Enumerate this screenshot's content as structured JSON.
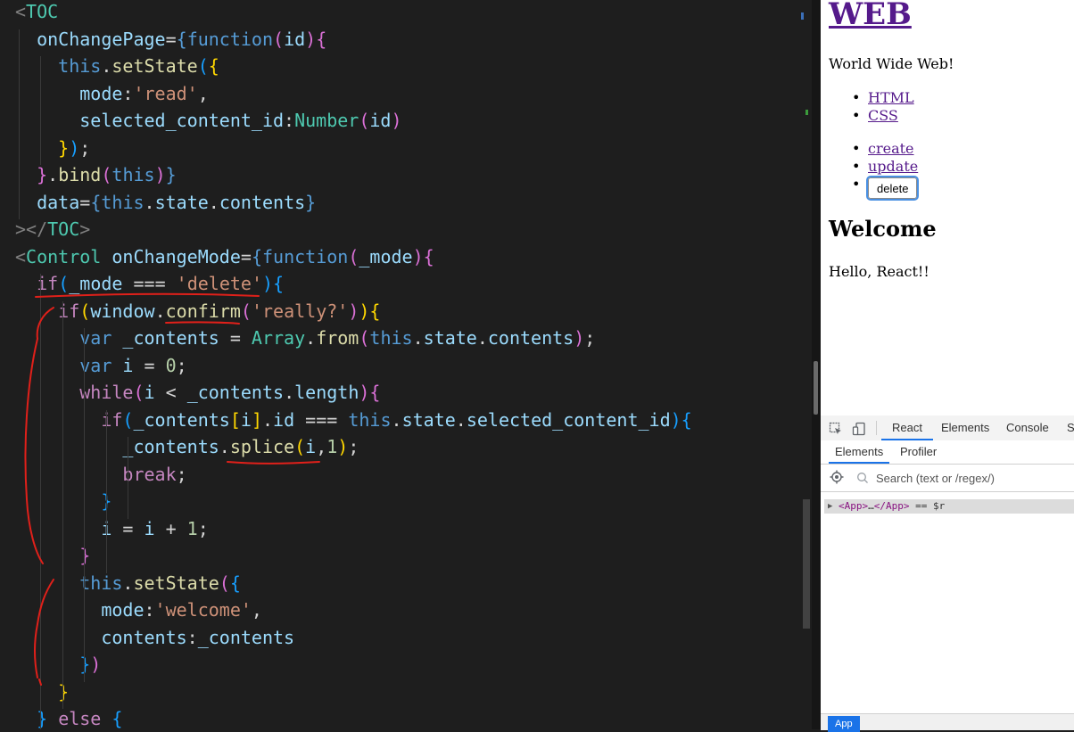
{
  "editor": {
    "lines": [
      [
        [
          "tk-tag",
          "<"
        ],
        [
          "tk-comp",
          "TOC"
        ]
      ],
      [
        [
          "tk-punc",
          "  "
        ],
        [
          "tk-attr",
          "onChangePage"
        ],
        [
          "tk-punc",
          "="
        ],
        [
          "tk-kw",
          "{"
        ],
        [
          "tk-kw",
          "function"
        ],
        [
          "tk-brace",
          "("
        ],
        [
          "tk-var",
          "id"
        ],
        [
          "tk-brace",
          ")"
        ],
        [
          "tk-brace",
          "{"
        ]
      ],
      [
        [
          "tk-punc",
          "    "
        ],
        [
          "tk-kw",
          "this"
        ],
        [
          "tk-punc",
          "."
        ],
        [
          "tk-fn",
          "setState"
        ],
        [
          "tk-brace2",
          "("
        ],
        [
          "tk-brace3",
          "{"
        ]
      ],
      [
        [
          "tk-punc",
          "      "
        ],
        [
          "tk-attr",
          "mode"
        ],
        [
          "tk-punc",
          ":"
        ],
        [
          "tk-str",
          "'read'"
        ],
        [
          "tk-punc",
          ","
        ]
      ],
      [
        [
          "tk-punc",
          "      "
        ],
        [
          "tk-attr",
          "selected_content_id"
        ],
        [
          "tk-punc",
          ":"
        ],
        [
          "tk-comp",
          "Number"
        ],
        [
          "tk-brace",
          "("
        ],
        [
          "tk-var",
          "id"
        ],
        [
          "tk-brace",
          ")"
        ]
      ],
      [
        [
          "tk-punc",
          "    "
        ],
        [
          "tk-brace3",
          "}"
        ],
        [
          "tk-brace2",
          ")"
        ],
        [
          "tk-punc",
          ";"
        ]
      ],
      [
        [
          "tk-punc",
          "  "
        ],
        [
          "tk-brace",
          "}"
        ],
        [
          "tk-punc",
          "."
        ],
        [
          "tk-fn",
          "bind"
        ],
        [
          "tk-brace",
          "("
        ],
        [
          "tk-kw",
          "this"
        ],
        [
          "tk-brace",
          ")"
        ],
        [
          "tk-kw",
          "}"
        ]
      ],
      [
        [
          "tk-punc",
          "  "
        ],
        [
          "tk-attr",
          "data"
        ],
        [
          "tk-punc",
          "="
        ],
        [
          "tk-kw",
          "{"
        ],
        [
          "tk-kw",
          "this"
        ],
        [
          "tk-punc",
          "."
        ],
        [
          "tk-var",
          "state"
        ],
        [
          "tk-punc",
          "."
        ],
        [
          "tk-var",
          "contents"
        ],
        [
          "tk-kw",
          "}"
        ]
      ],
      [
        [
          "tk-tag",
          "></"
        ],
        [
          "tk-comp",
          "TOC"
        ],
        [
          "tk-tag",
          ">"
        ]
      ],
      [
        [
          "tk-tag",
          "<"
        ],
        [
          "tk-comp",
          "Control"
        ],
        [
          "tk-punc",
          " "
        ],
        [
          "tk-attr",
          "onChangeMode"
        ],
        [
          "tk-punc",
          "="
        ],
        [
          "tk-kw",
          "{"
        ],
        [
          "tk-kw",
          "function"
        ],
        [
          "tk-brace",
          "("
        ],
        [
          "tk-var",
          "_mode"
        ],
        [
          "tk-brace",
          ")"
        ],
        [
          "tk-brace",
          "{"
        ]
      ],
      [
        [
          "tk-punc",
          "  "
        ],
        [
          "tk-ctl",
          "if"
        ],
        [
          "tk-brace2",
          "("
        ],
        [
          "tk-var",
          "_mode"
        ],
        [
          "tk-punc",
          " === "
        ],
        [
          "tk-str",
          "'delete'"
        ],
        [
          "tk-brace2",
          ")"
        ],
        [
          "tk-brace2",
          "{"
        ]
      ],
      [
        [
          "tk-punc",
          "    "
        ],
        [
          "tk-ctl",
          "if"
        ],
        [
          "tk-brace3",
          "("
        ],
        [
          "tk-var",
          "window"
        ],
        [
          "tk-punc",
          "."
        ],
        [
          "tk-fn",
          "confirm"
        ],
        [
          "tk-brace",
          "("
        ],
        [
          "tk-str",
          "'really?'"
        ],
        [
          "tk-brace",
          ")"
        ],
        [
          "tk-brace3",
          ")"
        ],
        [
          "tk-brace3",
          "{"
        ]
      ],
      [
        [
          "tk-punc",
          "      "
        ],
        [
          "tk-kw",
          "var"
        ],
        [
          "tk-punc",
          " "
        ],
        [
          "tk-var",
          "_contents"
        ],
        [
          "tk-punc",
          " = "
        ],
        [
          "tk-comp",
          "Array"
        ],
        [
          "tk-punc",
          "."
        ],
        [
          "tk-fn",
          "from"
        ],
        [
          "tk-brace",
          "("
        ],
        [
          "tk-kw",
          "this"
        ],
        [
          "tk-punc",
          "."
        ],
        [
          "tk-var",
          "state"
        ],
        [
          "tk-punc",
          "."
        ],
        [
          "tk-var",
          "contents"
        ],
        [
          "tk-brace",
          ")"
        ],
        [
          "tk-punc",
          ";"
        ]
      ],
      [
        [
          "tk-punc",
          "      "
        ],
        [
          "tk-kw",
          "var"
        ],
        [
          "tk-punc",
          " "
        ],
        [
          "tk-var",
          "i"
        ],
        [
          "tk-punc",
          " = "
        ],
        [
          "tk-num",
          "0"
        ],
        [
          "tk-punc",
          ";"
        ]
      ],
      [
        [
          "tk-punc",
          "      "
        ],
        [
          "tk-ctl",
          "while"
        ],
        [
          "tk-brace",
          "("
        ],
        [
          "tk-var",
          "i"
        ],
        [
          "tk-punc",
          " < "
        ],
        [
          "tk-var",
          "_contents"
        ],
        [
          "tk-punc",
          "."
        ],
        [
          "tk-var",
          "length"
        ],
        [
          "tk-brace",
          ")"
        ],
        [
          "tk-brace",
          "{"
        ]
      ],
      [
        [
          "tk-punc",
          "        "
        ],
        [
          "tk-ctl",
          "if"
        ],
        [
          "tk-brace2",
          "("
        ],
        [
          "tk-var",
          "_contents"
        ],
        [
          "tk-brace3",
          "["
        ],
        [
          "tk-var",
          "i"
        ],
        [
          "tk-brace3",
          "]"
        ],
        [
          "tk-punc",
          "."
        ],
        [
          "tk-var",
          "id"
        ],
        [
          "tk-punc",
          " === "
        ],
        [
          "tk-kw",
          "this"
        ],
        [
          "tk-punc",
          "."
        ],
        [
          "tk-var",
          "state"
        ],
        [
          "tk-punc",
          "."
        ],
        [
          "tk-var",
          "selected_content_id"
        ],
        [
          "tk-brace2",
          ")"
        ],
        [
          "tk-brace2",
          "{"
        ]
      ],
      [
        [
          "tk-punc",
          "          "
        ],
        [
          "tk-var",
          "_contents"
        ],
        [
          "tk-punc",
          "."
        ],
        [
          "tk-fn",
          "splice"
        ],
        [
          "tk-brace3",
          "("
        ],
        [
          "tk-var",
          "i"
        ],
        [
          "tk-punc",
          ","
        ],
        [
          "tk-num",
          "1"
        ],
        [
          "tk-brace3",
          ")"
        ],
        [
          "tk-punc",
          ";"
        ]
      ],
      [
        [
          "tk-punc",
          "          "
        ],
        [
          "tk-ctl",
          "break"
        ],
        [
          "tk-punc",
          ";"
        ]
      ],
      [
        [
          "tk-punc",
          "        "
        ],
        [
          "tk-brace2",
          "}"
        ]
      ],
      [
        [
          "tk-punc",
          "        "
        ],
        [
          "tk-var",
          "i"
        ],
        [
          "tk-punc",
          " = "
        ],
        [
          "tk-var",
          "i"
        ],
        [
          "tk-punc",
          " + "
        ],
        [
          "tk-num",
          "1"
        ],
        [
          "tk-punc",
          ";"
        ]
      ],
      [
        [
          "tk-punc",
          "      "
        ],
        [
          "tk-brace",
          "}"
        ]
      ],
      [
        [
          "tk-punc",
          "      "
        ],
        [
          "tk-kw",
          "this"
        ],
        [
          "tk-punc",
          "."
        ],
        [
          "tk-fn",
          "setState"
        ],
        [
          "tk-brace",
          "("
        ],
        [
          "tk-brace2",
          "{"
        ]
      ],
      [
        [
          "tk-punc",
          "        "
        ],
        [
          "tk-attr",
          "mode"
        ],
        [
          "tk-punc",
          ":"
        ],
        [
          "tk-str",
          "'welcome'"
        ],
        [
          "tk-punc",
          ","
        ]
      ],
      [
        [
          "tk-punc",
          "        "
        ],
        [
          "tk-attr",
          "contents"
        ],
        [
          "tk-punc",
          ":"
        ],
        [
          "tk-var",
          "_contents"
        ]
      ],
      [
        [
          "tk-punc",
          "      "
        ],
        [
          "tk-brace2",
          "}"
        ],
        [
          "tk-brace",
          ")"
        ]
      ],
      [
        [
          "tk-punc",
          "    "
        ],
        [
          "tk-brace3",
          "}"
        ]
      ],
      [
        [
          "tk-punc",
          "  "
        ],
        [
          "tk-brace2",
          "}"
        ],
        [
          "tk-punc",
          " "
        ],
        [
          "tk-ctl",
          "else"
        ],
        [
          "tk-punc",
          " "
        ],
        [
          "tk-brace2",
          "{"
        ]
      ]
    ]
  },
  "page": {
    "title": "WEB",
    "description": "World Wide Web!",
    "toc": [
      "HTML",
      "CSS"
    ],
    "controls": {
      "create": "create",
      "update": "update",
      "delete": "delete"
    },
    "content_title": "Welcome",
    "content_body": "Hello, React!!"
  },
  "devtools": {
    "tabs": [
      "React",
      "Elements",
      "Console",
      "S"
    ],
    "active_tab": "React",
    "subtabs": [
      "Elements",
      "Profiler"
    ],
    "search_placeholder": "Search (text or /regex/)",
    "tree": {
      "open_tag": "<App>",
      "ellipsis": "…",
      "close_tag": "</App>",
      "suffix": " == $r"
    },
    "footer_chip": "App",
    "icons": [
      "select-element-icon",
      "device-toggle-icon",
      "search-icon",
      "expand-arrow-icon"
    ]
  },
  "colors": {
    "editor_bg": "#1e1e1e",
    "annotation_ink": "#e0201a",
    "link_visited": "#551a8b",
    "focus_ring": "#4a90e2",
    "devtools_accent": "#1a73e8"
  }
}
